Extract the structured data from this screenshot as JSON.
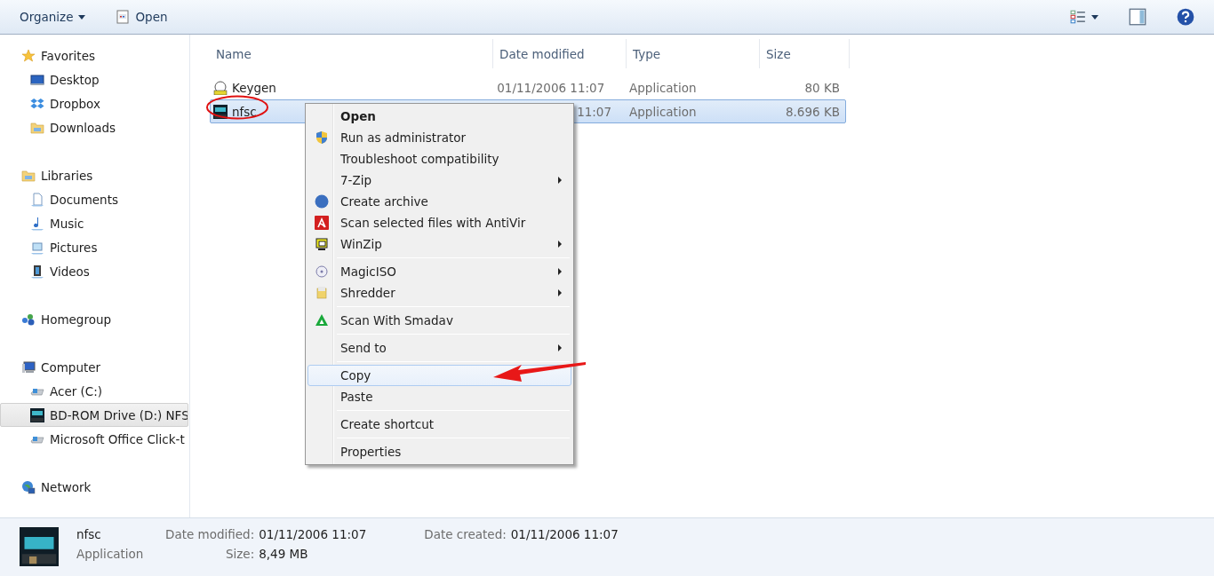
{
  "toolbar": {
    "organize": "Organize",
    "open": "Open"
  },
  "sidebar": [
    {
      "label": "Favorites",
      "kind": "star",
      "selected": false,
      "children": [
        {
          "label": "Desktop",
          "kind": "desktop",
          "selected": false
        },
        {
          "label": "Dropbox",
          "kind": "dropbox",
          "selected": false
        },
        {
          "label": "Downloads",
          "kind": "folder",
          "selected": false
        }
      ]
    },
    {
      "label": "Libraries",
      "kind": "folder",
      "selected": false,
      "children": [
        {
          "label": "Documents",
          "kind": "doc",
          "selected": false
        },
        {
          "label": "Music",
          "kind": "music",
          "selected": false
        },
        {
          "label": "Pictures",
          "kind": "pictures",
          "selected": false
        },
        {
          "label": "Videos",
          "kind": "videos",
          "selected": false
        }
      ]
    },
    {
      "label": "Homegroup",
      "kind": "homegroup",
      "selected": false
    },
    {
      "label": "Computer",
      "kind": "computer",
      "selected": false,
      "children": [
        {
          "label": "Acer (C:)",
          "kind": "drive",
          "selected": false
        },
        {
          "label": "BD-ROM Drive (D:) NFS",
          "kind": "nfs",
          "selected": true
        },
        {
          "label": "Microsoft Office Click-t",
          "kind": "drive",
          "selected": false
        }
      ]
    },
    {
      "label": "Network",
      "kind": "network",
      "selected": false
    }
  ],
  "table": {
    "columns": [
      "Name",
      "Date modified",
      "Type",
      "Size"
    ],
    "rows": [
      {
        "name": "Keygen",
        "kind": "keygen",
        "date": "01/11/2006 11:07",
        "date_covered": false,
        "type": "Application",
        "size": "80 KB",
        "selected": false
      },
      {
        "name": "nfsc",
        "kind": "nfs",
        "date": "11:07",
        "date_covered": true,
        "type": "Application",
        "size": "8.696 KB",
        "selected": true
      }
    ]
  },
  "context_menu": [
    [
      {
        "label": "Open",
        "kind": "plain",
        "default": true,
        "submenu": false,
        "highlighted": false
      },
      {
        "label": "Run as administrator",
        "kind": "shield",
        "default": false,
        "submenu": false,
        "highlighted": false
      },
      {
        "label": "Troubleshoot compatibility",
        "kind": "plain",
        "default": false,
        "submenu": false,
        "highlighted": false
      },
      {
        "label": "7-Zip",
        "kind": "plain",
        "default": false,
        "submenu": true,
        "highlighted": false
      },
      {
        "label": "Create archive",
        "kind": "b1",
        "default": false,
        "submenu": false,
        "highlighted": false
      },
      {
        "label": "Scan selected files with AntiVir",
        "kind": "antivir",
        "default": false,
        "submenu": false,
        "highlighted": false
      },
      {
        "label": "WinZip",
        "kind": "winzip",
        "default": false,
        "submenu": true,
        "highlighted": false
      }
    ],
    [
      {
        "label": "MagicISO",
        "kind": "disc",
        "default": false,
        "submenu": true,
        "highlighted": false
      },
      {
        "label": "Shredder",
        "kind": "shredder",
        "default": false,
        "submenu": true,
        "highlighted": false
      }
    ],
    [
      {
        "label": "Scan With Smadav",
        "kind": "smadav",
        "default": false,
        "submenu": false,
        "highlighted": false
      }
    ],
    [
      {
        "label": "Send to",
        "kind": "plain",
        "default": false,
        "submenu": true,
        "highlighted": false
      }
    ],
    [
      {
        "label": "Copy",
        "kind": "plain",
        "default": false,
        "submenu": false,
        "highlighted": true
      },
      {
        "label": "Paste",
        "kind": "plain",
        "default": false,
        "submenu": false,
        "highlighted": false
      }
    ],
    [
      {
        "label": "Create shortcut",
        "kind": "plain",
        "default": false,
        "submenu": false,
        "highlighted": false
      }
    ],
    [
      {
        "label": "Properties",
        "kind": "plain",
        "default": false,
        "submenu": false,
        "highlighted": false
      }
    ]
  ],
  "details": {
    "name": "nfsc",
    "type": "Application",
    "fields": [
      [
        {
          "label": "Date modified:",
          "value": "01/11/2006 11:07"
        },
        {
          "label": "Size:",
          "value": "8,49 MB"
        }
      ],
      [
        {
          "label": "Date created:",
          "value": "01/11/2006 11:07"
        }
      ]
    ]
  }
}
